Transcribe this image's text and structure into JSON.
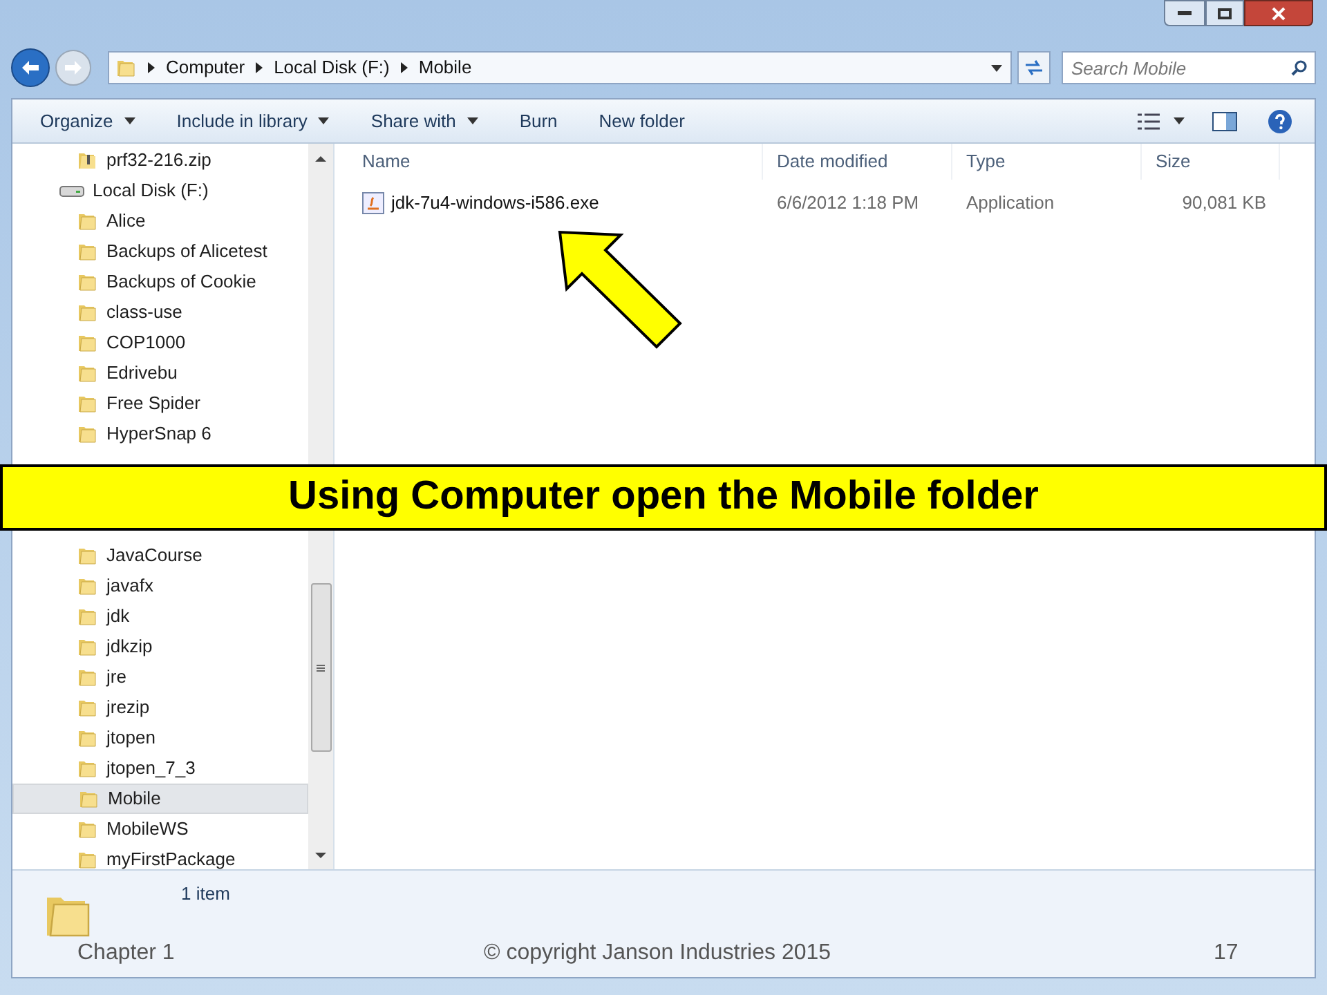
{
  "window": {
    "address": [
      "Computer",
      "Local Disk (F:)",
      "Mobile"
    ],
    "search": {
      "placeholder": "Search Mobile"
    }
  },
  "toolbar": [
    {
      "label": "Organize",
      "dropdown": true
    },
    {
      "label": "Include in library",
      "dropdown": true
    },
    {
      "label": "Share with",
      "dropdown": true
    },
    {
      "label": "Burn",
      "dropdown": false
    },
    {
      "label": "New folder",
      "dropdown": false
    }
  ],
  "nav": {
    "items": [
      {
        "kind": "zip",
        "label": "prf32-216.zip",
        "selected": false
      },
      {
        "kind": "drive",
        "label": "Local Disk (F:)",
        "selected": false,
        "children": [
          {
            "kind": "folder",
            "label": "Alice",
            "selected": false
          },
          {
            "kind": "folder",
            "label": "Backups of Alicetest",
            "selected": false
          },
          {
            "kind": "folder",
            "label": "Backups of Cookie",
            "selected": false
          },
          {
            "kind": "folder",
            "label": "class-use",
            "selected": false
          },
          {
            "kind": "folder",
            "label": "COP1000",
            "selected": false
          },
          {
            "kind": "folder",
            "label": "Edrivebu",
            "selected": false
          },
          {
            "kind": "folder",
            "label": "Free Spider",
            "selected": false
          },
          {
            "kind": "folder",
            "label": "HyperSnap 6",
            "selected": false
          },
          {
            "kind": "hidden"
          },
          {
            "kind": "hidden"
          },
          {
            "kind": "hidden"
          },
          {
            "kind": "folder",
            "label": "JavaCourse",
            "selected": false
          },
          {
            "kind": "folder",
            "label": "javafx",
            "selected": false
          },
          {
            "kind": "folder",
            "label": "jdk",
            "selected": false
          },
          {
            "kind": "folder",
            "label": "jdkzip",
            "selected": false
          },
          {
            "kind": "folder",
            "label": "jre",
            "selected": false
          },
          {
            "kind": "folder",
            "label": "jrezip",
            "selected": false
          },
          {
            "kind": "folder",
            "label": "jtopen",
            "selected": false
          },
          {
            "kind": "folder",
            "label": "jtopen_7_3",
            "selected": false
          },
          {
            "kind": "folder",
            "label": "Mobile",
            "selected": true
          },
          {
            "kind": "folder",
            "label": "MobileWS",
            "selected": false
          },
          {
            "kind": "folder",
            "label": "myFirstPackage",
            "selected": false
          }
        ]
      }
    ]
  },
  "files": {
    "columns": [
      "Name",
      "Date modified",
      "Type",
      "Size"
    ],
    "rows": [
      {
        "name": "jdk-7u4-windows-i586.exe",
        "date": "6/6/2012 1:18 PM",
        "type": "Application",
        "size": "90,081 KB"
      }
    ]
  },
  "status_bar": {
    "count": "1 item"
  },
  "banner": "Using Computer open the Mobile folder",
  "slide_footer": {
    "left": "Chapter 1",
    "center": "© copyright Janson Industries 2015",
    "page": "17"
  }
}
